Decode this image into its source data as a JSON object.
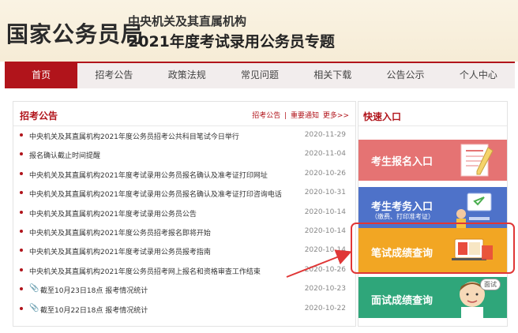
{
  "header": {
    "site_title": "国家公务员局",
    "subtitle_1": "中央机关及其直属机构",
    "subtitle_2": "2021年度考试录用公务员专题"
  },
  "nav": {
    "items": [
      "首页",
      "招考公告",
      "政策法规",
      "常见问题",
      "相关下载",
      "公告公示",
      "个人中心"
    ],
    "active_index": 0
  },
  "news_panel": {
    "title": "招考公告",
    "links": [
      "招考公告",
      "|",
      "重要通知",
      "更多>>"
    ],
    "items": [
      {
        "text": "中央机关及其直属机构2021年度公务员招考公共科目笔试今日举行",
        "date": "2020-11-29"
      },
      {
        "text": "报名确认截止时间提醒",
        "date": "2020-11-04"
      },
      {
        "text": "中央机关及其直属机构2021年度考试录用公务员报名确认及准考证打印网址",
        "date": "2020-10-26"
      },
      {
        "text": "中央机关及其直属机构2021年度考试录用公务员报名确认及准考证打印咨询电话",
        "date": "2020-10-31"
      },
      {
        "text": "中央机关及其直属机构2021年度考试录用公务员公告",
        "date": "2020-10-14"
      },
      {
        "text": "中央机关及其直属机构2021年度公务员招考报名即将开始",
        "date": "2020-10-14"
      },
      {
        "text": "中央机关及其直属机构2021年度考试录用公务员报考指南",
        "date": "2020-10-14"
      },
      {
        "text": "中央机关及其直属机构2021年度公务员招考网上报名和资格审查工作结束",
        "date": "2020-10-26"
      },
      {
        "text": "截至10月23日18点 报考情况统计",
        "date": "2020-10-23"
      },
      {
        "text": "截至10月22日18点 报考情况统计",
        "date": "2020-10-22"
      }
    ]
  },
  "quick_panel": {
    "title": "快速入口",
    "cards": [
      {
        "label": "考生报名入口",
        "sub": ""
      },
      {
        "label": "考生考务入口",
        "sub": "（缴费、打印准考证）"
      },
      {
        "label": "笔试成绩查询",
        "sub": ""
      },
      {
        "label": "面试成绩查询",
        "sub": "",
        "bubble": "面试"
      }
    ]
  },
  "colors": {
    "accent": "#b1141b",
    "card1": "#e57373",
    "card2": "#4e72c9",
    "card3": "#f2a623",
    "card4": "#2fa67a",
    "highlight": "#e03636"
  }
}
